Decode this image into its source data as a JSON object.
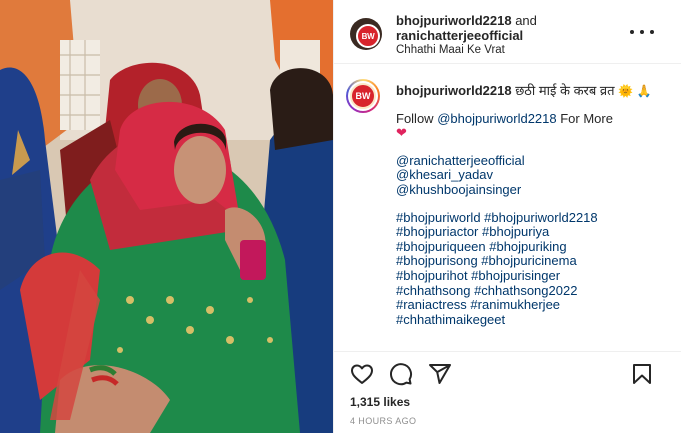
{
  "colors": {
    "accent": "#00376b",
    "heart": "#e0245e",
    "border": "#efefef",
    "muted": "#8e8e8e",
    "text": "#262626"
  },
  "media": {
    "description_icon": "video-frame"
  },
  "header": {
    "username_1": "bhojpuriworld2218",
    "and_text": " and ",
    "username_2": "ranichatterjeeofficial",
    "audio_label": "Chhathi Maai Ke Vrat",
    "avatar_monogram": "BW"
  },
  "caption": {
    "avatar_monogram": "BW",
    "username": "bhojpuriworld2218",
    "text": " छठी माई के करब व्रत ",
    "emoji_1": "🌞",
    "emoji_2": "🙏",
    "follow_prefix": "Follow ",
    "follow_handle": "@bhojpuriworld2218",
    "follow_suffix": " For More",
    "heart": "❤",
    "mentions": [
      "@ranichatterjeeofficial",
      "@khesari_yadav",
      "@khushboojainsinger"
    ],
    "hashtag_lines": [
      "#bhojpuriworld #bhojpuriworld2218",
      "#bhojpuriactor #bhojpuriya",
      "#bhojpuriqueen #bhojpuriking",
      "#bhojpurisong #bhojpuricinema",
      "#bhojpurihot #bhojpurisinger",
      "#chhathsong #chhathsong2022",
      "#raniactress #ranimukherjee",
      "#chhathimaikegeet"
    ]
  },
  "actions": {
    "like_icon": "heart-outline-icon",
    "comment_icon": "comment-icon",
    "share_icon": "paper-plane-icon",
    "save_icon": "bookmark-icon"
  },
  "likes_text": "1,315 likes",
  "timestamp": "4 HOURS AGO"
}
